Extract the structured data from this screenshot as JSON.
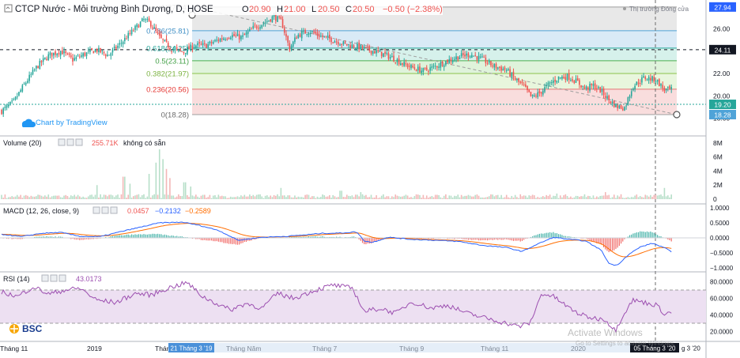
{
  "header": {
    "symbol_title": "CTCP Nước - Môi trường Bình Dương, D, HOSE",
    "ohlc": [
      {
        "label": "O",
        "value": "20.90"
      },
      {
        "label": "H",
        "value": "21.00"
      },
      {
        "label": "L",
        "value": "20.50"
      },
      {
        "label": "C",
        "value": "20.50"
      }
    ],
    "change": "−0.50 (−2.38%)",
    "market_status": "Thị trường Đóng cửa",
    "chart_by": "Chart by TradingView"
  },
  "colors": {
    "up": "#26a69a",
    "down": "#ef5350",
    "macd_line": "#2962ff",
    "signal_line": "#ff6d00",
    "rsi_line": "#9c4fb0",
    "rsi_band": "#ede0f2",
    "trendline": "#9e9e9e"
  },
  "fib": {
    "levels": [
      {
        "label": "1(27.94)",
        "value": 27.94,
        "fill": "#e6e6e6",
        "line": "#9e9e9e",
        "text_color": "#7a7a7a"
      },
      {
        "label": "0.786(25.81)",
        "value": 25.81,
        "fill": "#d5e8f5",
        "line": "#4fa3d8",
        "text_color": "#3f8fc5"
      },
      {
        "label": "0.618(24.25)",
        "value": 24.25,
        "fill": "#d2efe9",
        "line": "#26a69a",
        "text_color": "#26a69a"
      },
      {
        "label": "0.5(23.11)",
        "value": 23.11,
        "fill": "#dcf2d7",
        "line": "#4caf50",
        "text_color": "#43a047"
      },
      {
        "label": "0.382(21.97)",
        "value": 21.97,
        "fill": "#e6f5d9",
        "line": "#8bc34a",
        "text_color": "#7cb342"
      },
      {
        "label": "0.236(20.56)",
        "value": 20.56,
        "fill": "#f8d9d9",
        "line": "#e57373",
        "text_color": "#e53935"
      },
      {
        "label": "0(18.28)",
        "value": 18.28,
        "fill": "none",
        "line": "#9e9e9e",
        "text_color": "#6b6b6b"
      }
    ]
  },
  "price_axis": {
    "ticks": [
      "26.00",
      "24.00",
      "22.00",
      "20.00",
      "18.00"
    ],
    "badges": [
      {
        "value": 27.94,
        "text": "27.94",
        "color": "#2962ff"
      },
      {
        "value": 24.11,
        "text": "24.11",
        "color": "#131722"
      },
      {
        "value": 19.2,
        "text": "19.20",
        "color": "#26a69a"
      },
      {
        "value": 18.28,
        "text": "18.28",
        "color": "#4fa3d8"
      }
    ]
  },
  "volume": {
    "label": "Volume (20)",
    "value_text": "255.71K",
    "note": "không có sẵn",
    "ticks": [
      "8M",
      "6M",
      "4M",
      "2M",
      "0"
    ]
  },
  "macd": {
    "label": "MACD (12, 26, close, 9)",
    "values": [
      "0.0457",
      "−0.2132",
      "−0.2589"
    ],
    "ticks": [
      "1.0000",
      "0.5000",
      "0.0000",
      "−0.5000",
      "−1.0000"
    ]
  },
  "rsi": {
    "label": "RSI (14)",
    "value": "43.0173",
    "ticks": [
      "80.0000",
      "60.0000",
      "40.0000",
      "20.0000"
    ]
  },
  "time_axis": {
    "labels": [
      "Tháng 11",
      "2019",
      "Tháng",
      "Tháng Năm",
      "Tháng 7",
      "Tháng 9",
      "Tháng 11",
      "2020"
    ],
    "highlight_left": "21 Tháng 3 '19",
    "highlight_right": "05 Tháng 3 '20",
    "highlight_right_tail": "g 3 '20"
  },
  "watermark": {
    "title": "Activate Windows",
    "subtitle": "Go to Settings to activate Windows."
  },
  "logo": {
    "text": "BSC"
  },
  "chart_data": {
    "type": "candlestick",
    "x_range": [
      "Tháng 10 2018",
      "05 Tháng 3 '20"
    ],
    "y_axis": {
      "label": "",
      "range": [
        17.5,
        28.0
      ]
    },
    "last": {
      "open": 20.9,
      "high": 21.0,
      "low": 20.5,
      "close": 20.5,
      "change": -0.5,
      "change_pct": -2.38
    },
    "price_anchors": [
      [
        0,
        18.6
      ],
      [
        15,
        19.4
      ],
      [
        30,
        21.1
      ],
      [
        45,
        22.6
      ],
      [
        60,
        23.6
      ],
      [
        75,
        24.0
      ],
      [
        90,
        23.2
      ],
      [
        105,
        23.7
      ],
      [
        120,
        24.1
      ],
      [
        135,
        23.6
      ],
      [
        150,
        24.6
      ],
      [
        165,
        25.7
      ],
      [
        180,
        26.8
      ],
      [
        190,
        26.4
      ],
      [
        200,
        25.2
      ],
      [
        215,
        24.2
      ],
      [
        230,
        23.9
      ],
      [
        245,
        24.5
      ],
      [
        260,
        24.5
      ],
      [
        275,
        25.0
      ],
      [
        290,
        25.4
      ],
      [
        305,
        25.2
      ],
      [
        320,
        26.1
      ],
      [
        335,
        26.6
      ],
      [
        345,
        27.1
      ],
      [
        355,
        26.6
      ],
      [
        365,
        24.2
      ],
      [
        375,
        25.4
      ],
      [
        390,
        25.8
      ],
      [
        405,
        25.3
      ],
      [
        420,
        25.0
      ],
      [
        435,
        24.6
      ],
      [
        450,
        24.4
      ],
      [
        465,
        24.1
      ],
      [
        480,
        23.8
      ],
      [
        495,
        23.4
      ],
      [
        510,
        22.8
      ],
      [
        525,
        22.4
      ],
      [
        535,
        22.2
      ],
      [
        550,
        22.6
      ],
      [
        565,
        23.1
      ],
      [
        580,
        23.5
      ],
      [
        595,
        23.7
      ],
      [
        610,
        23.2
      ],
      [
        625,
        22.6
      ],
      [
        640,
        22.3
      ],
      [
        650,
        21.5
      ],
      [
        662,
        20.8
      ],
      [
        672,
        19.8
      ],
      [
        682,
        20.2
      ],
      [
        694,
        21.0
      ],
      [
        706,
        21.6
      ],
      [
        718,
        21.7
      ],
      [
        730,
        21.2
      ],
      [
        740,
        20.6
      ],
      [
        750,
        20.9
      ],
      [
        760,
        20.4
      ],
      [
        770,
        19.6
      ],
      [
        780,
        19.0
      ],
      [
        790,
        18.9
      ],
      [
        800,
        20.8
      ],
      [
        815,
        21.6
      ],
      [
        830,
        21.4
      ],
      [
        840,
        20.5
      ],
      [
        850,
        20.5
      ]
    ],
    "volume_spikes_millions": [
      [
        122,
        2.0
      ],
      [
        155,
        3.2
      ],
      [
        162,
        2.2
      ],
      [
        186,
        3.6
      ],
      [
        196,
        5.2
      ],
      [
        200,
        7.1
      ],
      [
        204,
        5.7
      ],
      [
        208,
        4.3
      ],
      [
        214,
        3.0
      ],
      [
        232,
        2.4
      ],
      [
        240,
        1.8
      ],
      [
        354,
        1.6
      ],
      [
        430,
        1.2
      ],
      [
        455,
        1.0
      ],
      [
        705,
        0.8
      ],
      [
        766,
        1.0
      ],
      [
        840,
        1.6
      ]
    ],
    "volume_range": [
      0,
      9
    ],
    "macd_range": [
      -1.05,
      1.05
    ],
    "macd_anchors": [
      [
        0,
        0.12
      ],
      [
        25,
        0.04
      ],
      [
        50,
        0.15
      ],
      [
        75,
        0.18
      ],
      [
        100,
        0.05
      ],
      [
        125,
        0.04
      ],
      [
        150,
        0.2
      ],
      [
        180,
        0.38
      ],
      [
        200,
        0.5
      ],
      [
        230,
        0.52
      ],
      [
        250,
        0.42
      ],
      [
        275,
        0.25
      ],
      [
        300,
        -0.08
      ],
      [
        330,
        0.02
      ],
      [
        360,
        0.05
      ],
      [
        385,
        0.1
      ],
      [
        405,
        0.15
      ],
      [
        430,
        0.16
      ],
      [
        450,
        0.2
      ],
      [
        460,
        -0.1
      ],
      [
        470,
        -0.15
      ],
      [
        490,
        0.02
      ],
      [
        520,
        -0.05
      ],
      [
        550,
        -0.08
      ],
      [
        580,
        -0.12
      ],
      [
        610,
        -0.25
      ],
      [
        640,
        -0.32
      ],
      [
        660,
        -0.45
      ],
      [
        680,
        -0.2
      ],
      [
        700,
        0.02
      ],
      [
        720,
        -0.05
      ],
      [
        740,
        -0.1
      ],
      [
        760,
        -0.4
      ],
      [
        770,
        -0.85
      ],
      [
        780,
        -0.92
      ],
      [
        795,
        -0.55
      ],
      [
        810,
        -0.3
      ],
      [
        825,
        -0.18
      ],
      [
        840,
        -0.32
      ],
      [
        850,
        -0.48
      ]
    ],
    "rsi_range": [
      10,
      90
    ],
    "rsi_anchors": [
      [
        0,
        68
      ],
      [
        20,
        62
      ],
      [
        40,
        74
      ],
      [
        60,
        65
      ],
      [
        80,
        70
      ],
      [
        100,
        72
      ],
      [
        120,
        58
      ],
      [
        145,
        55
      ],
      [
        170,
        66
      ],
      [
        190,
        64
      ],
      [
        210,
        72
      ],
      [
        235,
        79
      ],
      [
        255,
        62
      ],
      [
        270,
        55
      ],
      [
        290,
        46
      ],
      [
        310,
        54
      ],
      [
        330,
        48
      ],
      [
        350,
        66
      ],
      [
        370,
        60
      ],
      [
        395,
        69
      ],
      [
        420,
        76
      ],
      [
        445,
        72
      ],
      [
        460,
        44
      ],
      [
        480,
        48
      ],
      [
        500,
        42
      ],
      [
        520,
        56
      ],
      [
        545,
        48
      ],
      [
        565,
        52
      ],
      [
        590,
        42
      ],
      [
        615,
        36
      ],
      [
        640,
        30
      ],
      [
        655,
        26
      ],
      [
        670,
        30
      ],
      [
        685,
        66
      ],
      [
        700,
        62
      ],
      [
        720,
        48
      ],
      [
        735,
        40
      ],
      [
        750,
        36
      ],
      [
        765,
        35
      ],
      [
        778,
        21
      ],
      [
        788,
        40
      ],
      [
        800,
        58
      ],
      [
        815,
        55
      ],
      [
        830,
        52
      ],
      [
        840,
        42
      ],
      [
        850,
        43
      ]
    ]
  }
}
